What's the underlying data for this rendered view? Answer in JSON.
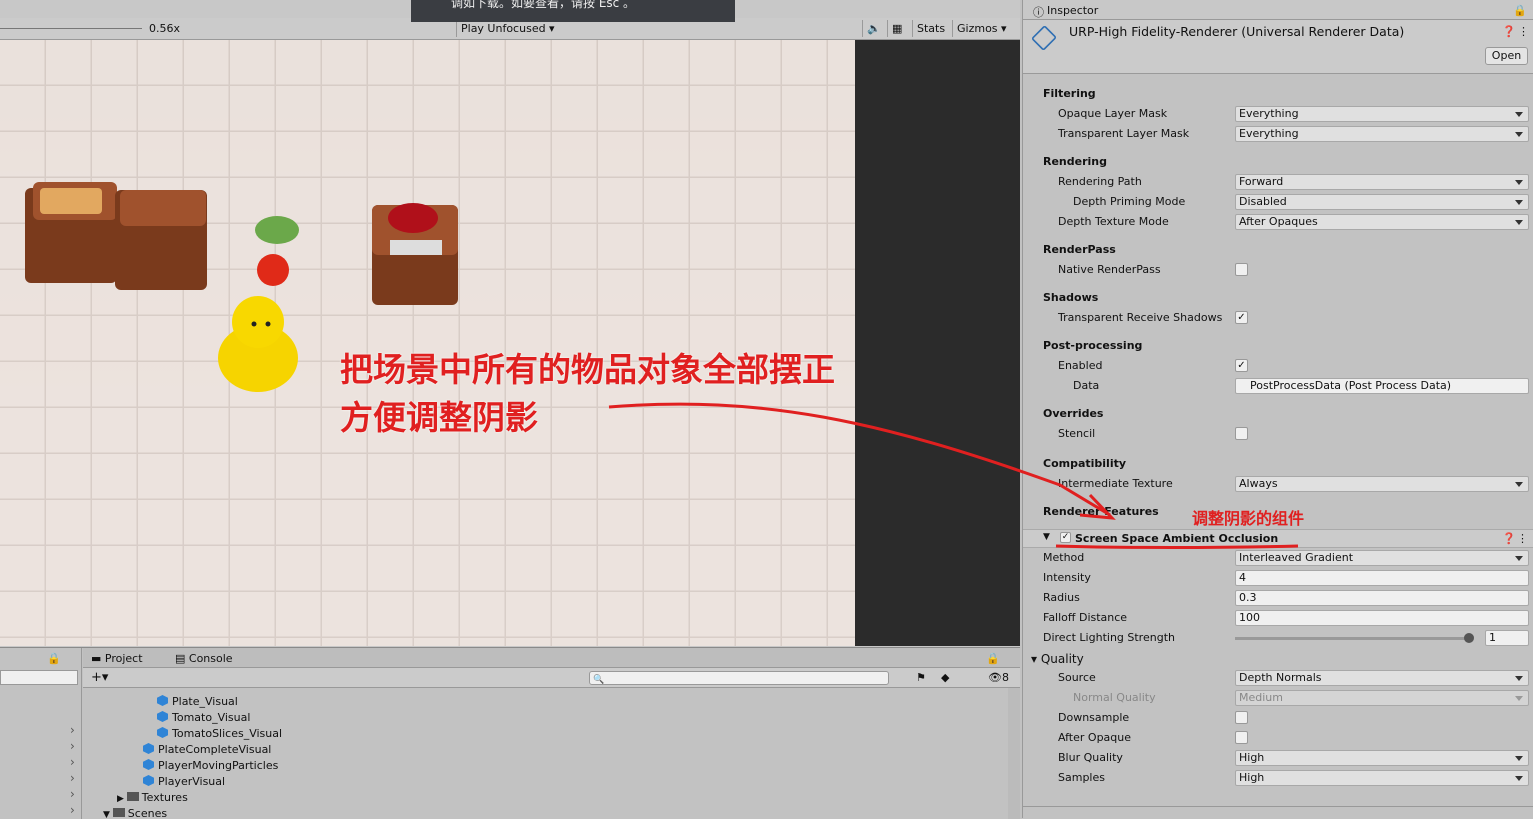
{
  "game_view": {
    "zoom_label": "0.56x",
    "play_mode": "Play Unfocused",
    "stats_label": "Stats",
    "gizmos_label": "Gizmos",
    "overlay_banner": "调如下载。如要查看，请按 Esc 。"
  },
  "annotation": {
    "line1": "把场景中所有的物品对象全部摆正",
    "line2": "方便调整阴影",
    "component_note": "调整阴影的组件",
    "color": "#e02020"
  },
  "inspector": {
    "tab_label": "Inspector",
    "asset_title": "URP-High Fidelity-Renderer (Universal Renderer Data)",
    "open_label": "Open",
    "sections": {
      "filtering": "Filtering",
      "rendering": "Rendering",
      "renderpass": "RenderPass",
      "shadows": "Shadows",
      "postprocessing": "Post-processing",
      "overrides": "Overrides",
      "compatibility": "Compatibility",
      "renderer_features": "Renderer Features"
    },
    "fields": {
      "opaque_layer_mask": {
        "label": "Opaque Layer Mask",
        "value": "Everything"
      },
      "transparent_layer_mask": {
        "label": "Transparent Layer Mask",
        "value": "Everything"
      },
      "rendering_path": {
        "label": "Rendering Path",
        "value": "Forward"
      },
      "depth_priming_mode": {
        "label": "Depth Priming Mode",
        "value": "Disabled"
      },
      "depth_texture_mode": {
        "label": "Depth Texture Mode",
        "value": "After Opaques"
      },
      "native_renderpass": {
        "label": "Native RenderPass",
        "checked": false
      },
      "transparent_receive_shadows": {
        "label": "Transparent Receive Shadows",
        "checked": true
      },
      "pp_enabled": {
        "label": "Enabled",
        "checked": true
      },
      "pp_data": {
        "label": "Data",
        "value": "PostProcessData (Post Process Data)"
      },
      "stencil": {
        "label": "Stencil",
        "checked": false
      },
      "intermediate_texture": {
        "label": "Intermediate Texture",
        "value": "Always"
      }
    },
    "ssao": {
      "title": "Screen Space Ambient Occlusion",
      "enabled": true,
      "method": {
        "label": "Method",
        "value": "Interleaved Gradient"
      },
      "intensity": {
        "label": "Intensity",
        "value": "4"
      },
      "radius": {
        "label": "Radius",
        "value": "0.3"
      },
      "falloff": {
        "label": "Falloff Distance",
        "value": "100"
      },
      "direct_lighting": {
        "label": "Direct Lighting Strength",
        "value": "1",
        "fraction": 1.0
      },
      "quality_label": "Quality",
      "source": {
        "label": "Source",
        "value": "Depth Normals"
      },
      "normal_quality": {
        "label": "Normal Quality",
        "value": "Medium"
      },
      "downsample": {
        "label": "Downsample",
        "checked": false
      },
      "after_opaque": {
        "label": "After Opaque",
        "checked": false
      },
      "blur_quality": {
        "label": "Blur Quality",
        "value": "High"
      },
      "samples": {
        "label": "Samples",
        "value": "High"
      }
    }
  },
  "project": {
    "tab_project": "Project",
    "tab_console": "Console",
    "visible_count": "8",
    "tree": [
      {
        "name": "Plate_Visual",
        "type": "prefab"
      },
      {
        "name": "Tomato_Visual",
        "type": "prefab"
      },
      {
        "name": "TomatoSlices_Visual",
        "type": "prefab"
      },
      {
        "name": "PlateCompleteVisual",
        "type": "prefab"
      },
      {
        "name": "PlayerMovingParticles",
        "type": "prefab"
      },
      {
        "name": "PlayerVisual",
        "type": "prefab"
      },
      {
        "name": "Textures",
        "type": "folder"
      },
      {
        "name": "Scenes",
        "type": "folder"
      }
    ]
  }
}
